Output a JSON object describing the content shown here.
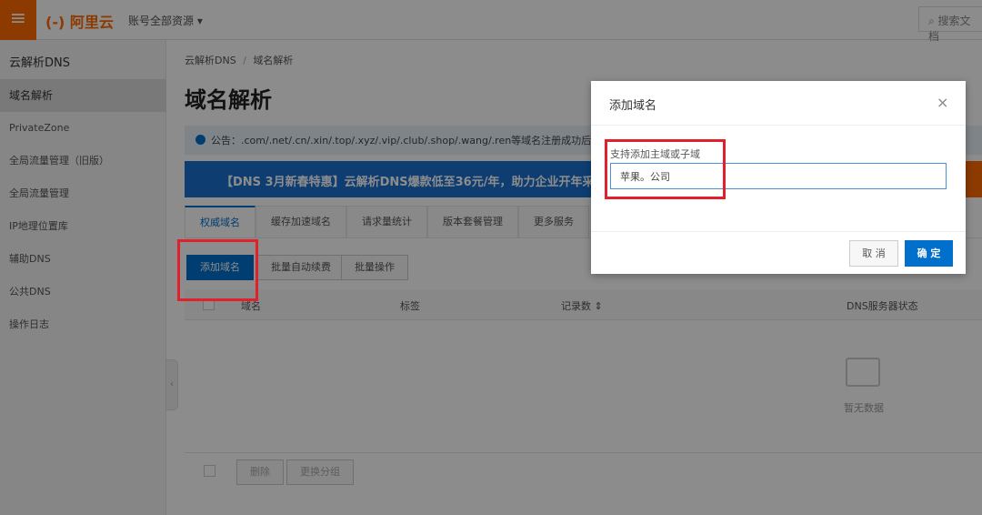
{
  "header": {
    "menu_icon": "hamburger-icon",
    "logo": "(-) 阿里云",
    "account_menu": "账号全部资源 ▾",
    "search_placeholder": "搜索文档"
  },
  "sidebar": {
    "title": "云解析DNS",
    "items": [
      {
        "label": "域名解析",
        "active": true
      },
      {
        "label": "PrivateZone"
      },
      {
        "label": "全局流量管理（旧版）"
      },
      {
        "label": "全局流量管理"
      },
      {
        "label": "IP地理位置库"
      },
      {
        "label": "辅助DNS"
      },
      {
        "label": "公共DNS"
      },
      {
        "label": "操作日志"
      }
    ],
    "collapse": "‹"
  },
  "main": {
    "breadcrumb": [
      "云解析DNS",
      "/",
      "域名解析"
    ],
    "title": "域名解析",
    "notice": "公告：.com/.net/.cn/.xin/.top/.xyz/.vip/.club/.shop/.wang/.ren等域名注册成功后必须进行",
    "banner": "【DNS 3月新春特惠】云解析DNS爆款低至36元/年，助力企业开年采购。",
    "tabs": [
      "权威域名",
      "缓存加速域名",
      "请求量统计",
      "版本套餐管理",
      "更多服务"
    ],
    "actions": [
      "添加域名",
      "批量自动续费",
      "批量操作"
    ],
    "columns": [
      "域名",
      "标签",
      "记录数 ⇕",
      "DNS服务器状态"
    ],
    "empty": "暂无数据",
    "footer_actions": [
      "删除",
      "更换分组"
    ]
  },
  "dialog": {
    "title": "添加域名",
    "close": "×",
    "label": "支持添加主域或子域",
    "input_value": "苹果。公司",
    "cancel": "取 消",
    "ok": "确 定"
  }
}
